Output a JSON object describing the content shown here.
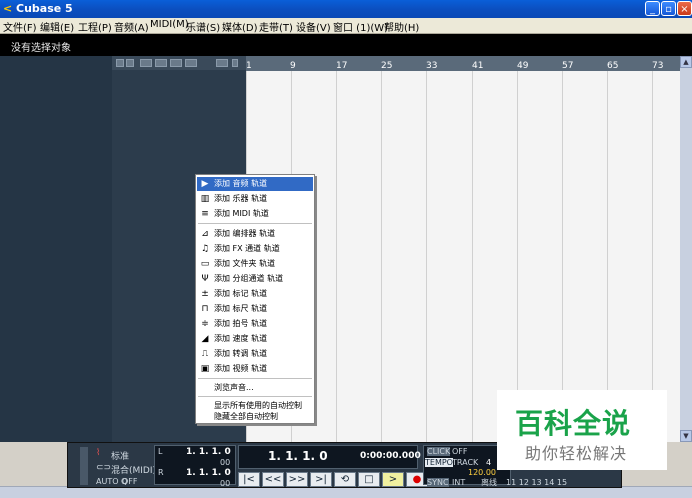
{
  "window": {
    "title": "Cubase 5",
    "logo": "<"
  },
  "menu": [
    "文件(F)",
    "编辑(E)",
    "工程(P)",
    "音频(A)",
    "MIDI(M)",
    "乐谱(S)",
    "媒体(D)",
    "走带(T)",
    "设备(V)",
    "窗口 (1)(W)",
    "帮助(H)"
  ],
  "info_line": "没有选择对象",
  "ruler": [
    "1",
    "9",
    "17",
    "25",
    "33",
    "41",
    "49",
    "57",
    "65",
    "73"
  ],
  "context_menu": [
    {
      "icon": "▶",
      "label": "添加 音频 轨道",
      "highlighted": true
    },
    {
      "icon": "▥",
      "label": "添加 乐器 轨道"
    },
    {
      "icon": "≡",
      "label": "添加 MIDI 轨道"
    },
    {
      "icon": "⊿",
      "label": "添加 编排器 轨道"
    },
    {
      "icon": "♫",
      "label": "添加 FX 通道 轨道"
    },
    {
      "icon": "▭",
      "label": "添加 文件夹 轨道"
    },
    {
      "icon": "Ψ",
      "label": "添加 分组通道 轨道"
    },
    {
      "icon": "±",
      "label": "添加 标记 轨道"
    },
    {
      "icon": "⊓",
      "label": "添加 标尺 轨道"
    },
    {
      "icon": "≑",
      "label": "添加 拍号 轨道"
    },
    {
      "icon": "◢",
      "label": "添加 速度 轨道"
    },
    {
      "icon": "⎍",
      "label": "添加 转调 轨道"
    },
    {
      "icon": "▣",
      "label": "添加 视频 轨道"
    },
    {
      "icon": "",
      "label": "浏览声音..."
    },
    {
      "icon": "",
      "label": "显示所有使用的自动控制"
    },
    {
      "icon": "",
      "label": "隐藏全部自动控制"
    }
  ],
  "transport": {
    "mode": "标准",
    "mix": "混合(MIDI)",
    "auto_q": "AUTO Q",
    "auto_q_val": "OFF",
    "left_locator": "1. 1. 1.   0",
    "right_locator": "1. 1. 1.   0",
    "left_tag": "L",
    "right_tag": "R",
    "left_aux": "00",
    "right_aux": "00",
    "position_bars": "1. 1. 1.   0",
    "position_time": "0:00:00.000",
    "click_label": "CLICK",
    "click_val": "OFF",
    "tempo_label": "TEMPO",
    "tempo_mode": "TRACK",
    "tempo_num": "4",
    "tempo_val": "120.00",
    "sync_label": "SYNC",
    "sync_val": "INT",
    "offline": "离线",
    "numbers": "11 12 13 14 15",
    "buttons": [
      "|<",
      "<<",
      ">>",
      ">|",
      "⟲",
      "□",
      ">",
      "●"
    ]
  },
  "watermark": {
    "line1": "百科全说",
    "line2": "助你轻松解决"
  }
}
